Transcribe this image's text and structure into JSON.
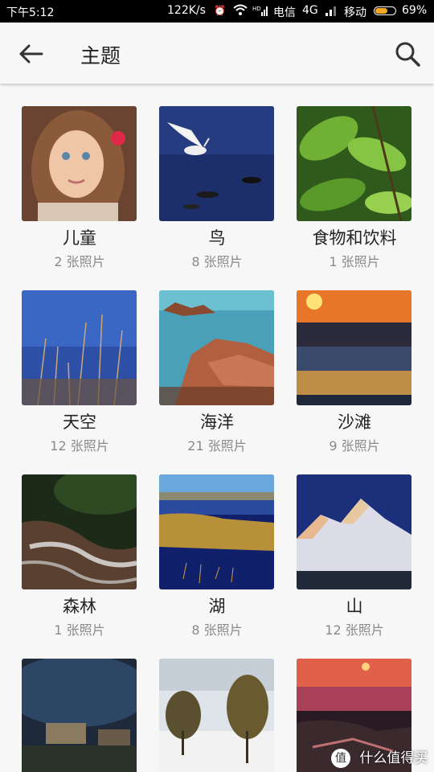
{
  "status_bar": {
    "time": "下午5:12",
    "speed": "122K/s",
    "carrier1": "电信",
    "network": "4G",
    "carrier2": "移动",
    "battery": "69%",
    "battery_fraction": 0.69,
    "icons": [
      "alarm-icon",
      "wifi-icon",
      "hd-signal-icon",
      "signal-icon",
      "battery-icon"
    ]
  },
  "header": {
    "title": "主题",
    "back_icon": "arrow-left-icon",
    "search_icon": "search-icon"
  },
  "themes": [
    {
      "name": "儿童",
      "count": "2 张照片",
      "thumb": "child-portrait"
    },
    {
      "name": "鸟",
      "count": "8 张照片",
      "thumb": "egret-over-water"
    },
    {
      "name": "食物和饮料",
      "count": "1 张照片",
      "thumb": "cherry-leaves"
    },
    {
      "name": "天空",
      "count": "12 张照片",
      "thumb": "reeds-under-sky"
    },
    {
      "name": "海洋",
      "count": "21 张照片",
      "thumb": "rocky-coast"
    },
    {
      "name": "沙滩",
      "count": "9 张照片",
      "thumb": "beach-sunset"
    },
    {
      "name": "森林",
      "count": "1 张照片",
      "thumb": "forest-stream"
    },
    {
      "name": "湖",
      "count": "8 张照片",
      "thumb": "lake-grass"
    },
    {
      "name": "山",
      "count": "12 张照片",
      "thumb": "snowy-mountain"
    },
    {
      "name": "",
      "count": "",
      "thumb": "stormy-village"
    },
    {
      "name": "",
      "count": "",
      "thumb": "snowy-trees"
    },
    {
      "name": "",
      "count": "",
      "thumb": "sea-sunset"
    }
  ],
  "watermark": {
    "badge": "值",
    "text": "什么值得买"
  },
  "colors": {
    "accent_battery": "#f5a623",
    "text_primary": "#222222",
    "text_secondary": "#8a8a8a"
  }
}
